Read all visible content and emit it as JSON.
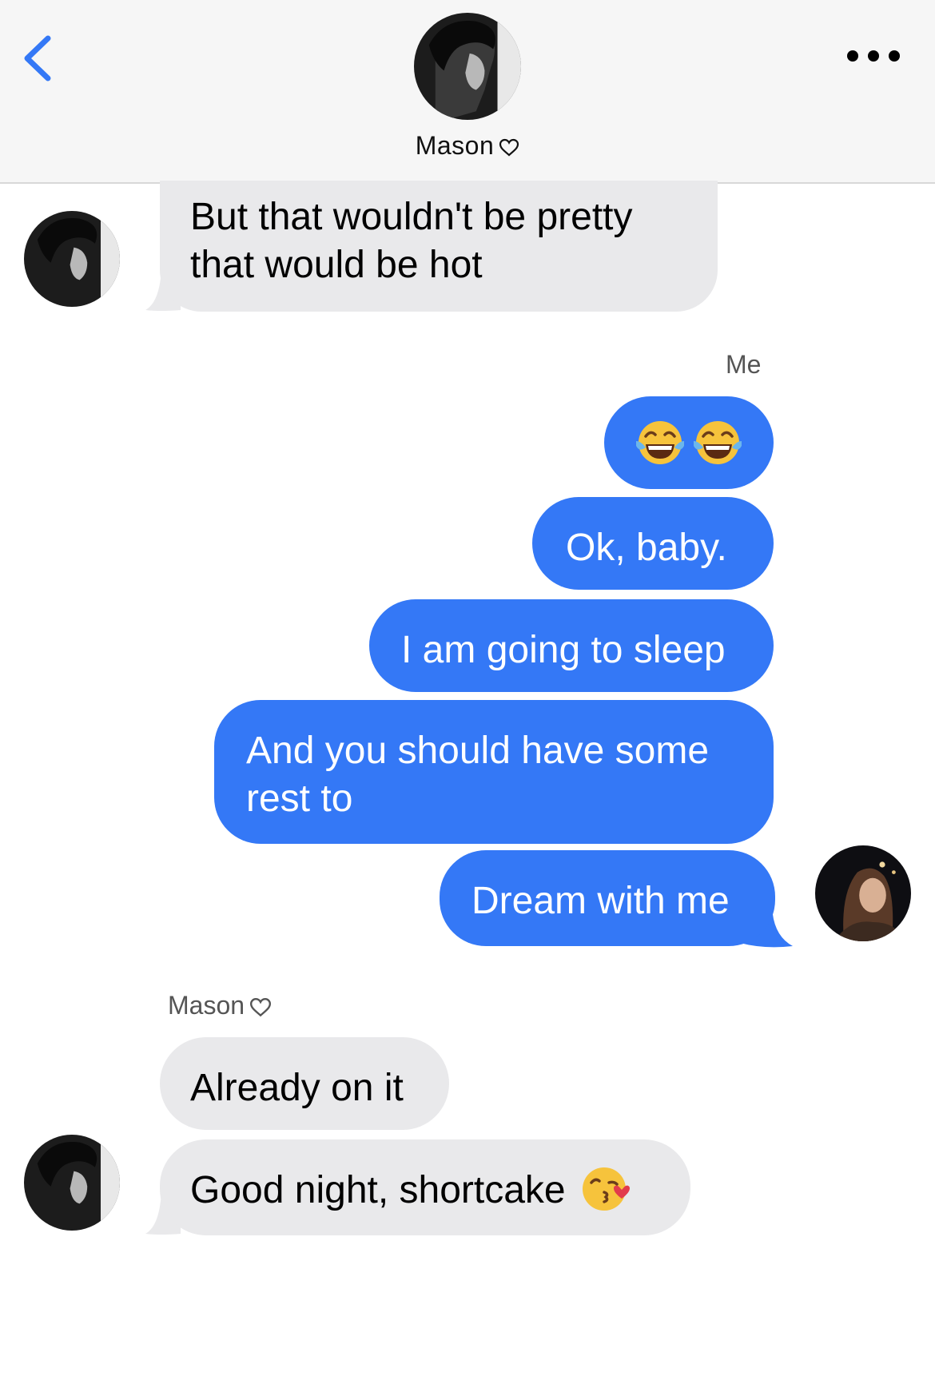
{
  "header": {
    "contact_name": "Mason",
    "back_icon": "chevron-left-icon",
    "more_icon": "more-dots-icon",
    "accent_color": "#3478f6"
  },
  "labels": {
    "me": "Me",
    "mason": "Mason"
  },
  "messages": [
    {
      "from": "mason",
      "lines": [
        "But that wouldn't be pretty",
        "that would be hot"
      ]
    },
    {
      "from": "me",
      "text": "",
      "emojis": [
        "face-with-tears-of-joy",
        "face-with-tears-of-joy"
      ]
    },
    {
      "from": "me",
      "text": "Ok, baby."
    },
    {
      "from": "me",
      "text": "I am going to sleep"
    },
    {
      "from": "me",
      "lines": [
        "And you should have some",
        "rest to"
      ]
    },
    {
      "from": "me",
      "text": "Dream with me"
    },
    {
      "from": "mason",
      "text": "Already on it"
    },
    {
      "from": "mason",
      "text": "Good night, shortcake",
      "emojis": [
        "face-blowing-a-kiss"
      ]
    }
  ],
  "colors": {
    "outgoing_bubble": "#3478f6",
    "incoming_bubble": "#e9e9eb"
  }
}
